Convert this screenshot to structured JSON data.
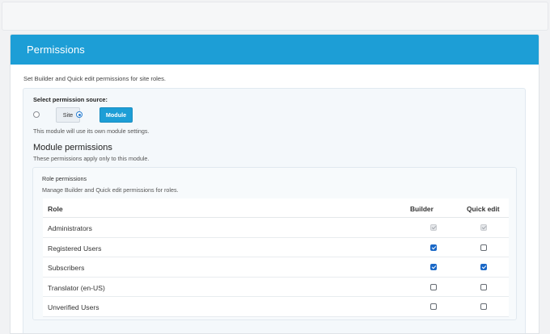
{
  "header": {
    "title": "Permissions"
  },
  "intro": "Set Builder and Quick edit permissions for site roles.",
  "source": {
    "label": "Select permission source:",
    "options": [
      {
        "label": "Site",
        "selected": false
      },
      {
        "label": "Module",
        "selected": true
      }
    ],
    "note": "This module will use its own module settings."
  },
  "module": {
    "title": "Module permissions",
    "subtitle": "These permissions apply only to this module."
  },
  "roles": {
    "title": "Role permissions",
    "description": "Manage Builder and Quick edit permissions for roles.",
    "columns": {
      "role": "Role",
      "builder": "Builder",
      "quick": "Quick edit"
    },
    "rows": [
      {
        "name": "Administrators",
        "builder": "disabled",
        "quick": "disabled"
      },
      {
        "name": "Registered Users",
        "builder": "checked",
        "quick": "unchecked"
      },
      {
        "name": "Subscribers",
        "builder": "checked",
        "quick": "checked"
      },
      {
        "name": "Translator (en-US)",
        "builder": "unchecked",
        "quick": "unchecked"
      },
      {
        "name": "Unverified Users",
        "builder": "unchecked",
        "quick": "unchecked"
      }
    ]
  },
  "colors": {
    "accent": "#1d9ed6",
    "checkbox": "#1a68c7"
  }
}
